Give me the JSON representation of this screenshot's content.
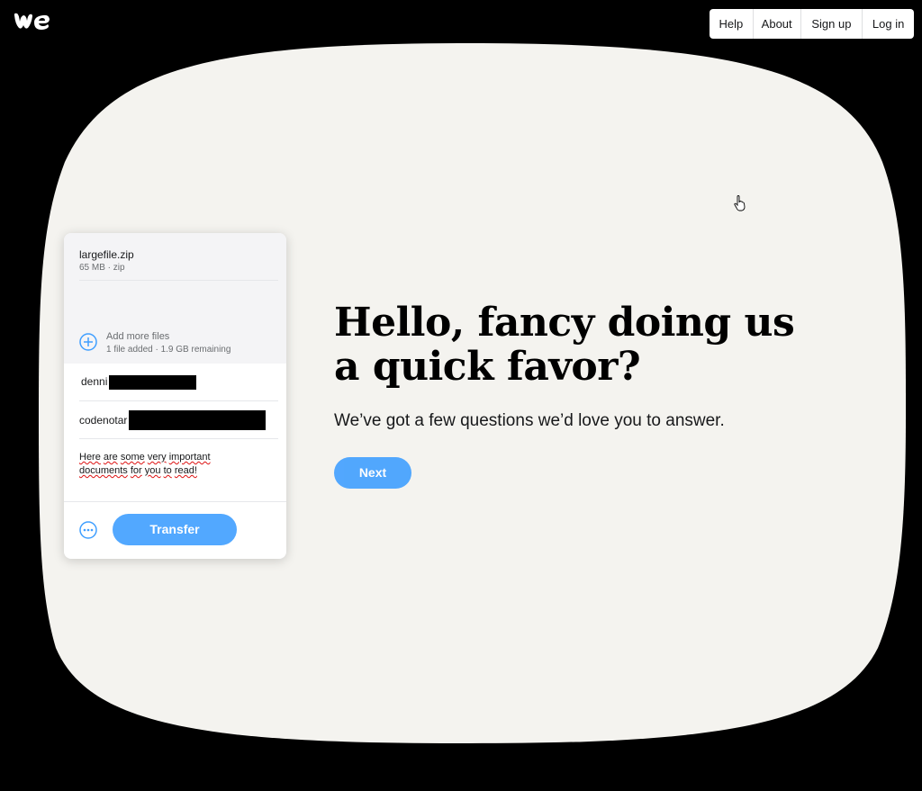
{
  "nav": {
    "items": [
      "Help",
      "About",
      "Sign up",
      "Log in"
    ]
  },
  "transfer_panel": {
    "file_name": "largefile.zip",
    "file_meta": "65 MB · zip",
    "add_more_label": "Add more files",
    "add_more_status": "1 file added · 1.9 GB remaining",
    "email_to_visible": "denni",
    "email_from_visible": "codenotar",
    "message_words": [
      "Here",
      "are",
      "some",
      "very",
      "important",
      "documents",
      "for",
      "you",
      "to",
      "read!"
    ],
    "transfer_label": "Transfer"
  },
  "survey": {
    "headline_line1": "Hello, fancy doing us",
    "headline_line2": "a quick favor?",
    "subtext": "We’ve got a few questions we’d love you to answer.",
    "next_label": "Next"
  },
  "colors": {
    "accent": "#409fff",
    "card_bg": "#f4f3ef",
    "page_bg": "#000000"
  },
  "icons": [
    "wetransfer-logo",
    "add-files-icon",
    "more-options-icon",
    "hand-cursor-icon"
  ]
}
